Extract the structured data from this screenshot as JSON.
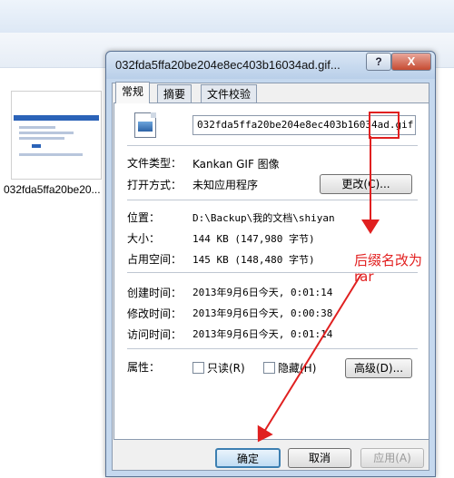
{
  "explorer": {
    "thumbnail_label": "032fda5ffa20be20..."
  },
  "dialog": {
    "title": "032fda5ffa20be204e8ec403b16034ad.gif...",
    "help_label": "?",
    "close_label": "X",
    "tabs": [
      "常规",
      "摘要",
      "文件校验"
    ],
    "file_name": "032fda5ffa20be204e8ec403b16034ad.gif",
    "type_label": "文件类型：",
    "type_value": "Kankan GIF 图像",
    "open_label": "打开方式：",
    "open_value": "未知应用程序",
    "change_button": "更改(C)...",
    "location_label": "位置：",
    "location_value": "D:\\Backup\\我的文档\\shiyan",
    "size_label": "大小：",
    "size_value": "144 KB (147,980 字节)",
    "disk_label": "占用空间：",
    "disk_value": "145 KB (148,480 字节)",
    "created_label": "创建时间：",
    "created_value": "2013年9月6日今天, 0:01:14",
    "modified_label": "修改时间：",
    "modified_value": "2013年9月6日今天, 0:00:38",
    "accessed_label": "访问时间：",
    "accessed_value": "2013年9月6日今天, 0:01:14",
    "attributes_label": "属性：",
    "readonly_label": "只读(R)",
    "hidden_label": "隐藏(H)",
    "advanced_button": "高级(D)...",
    "ok_button": "确定",
    "cancel_button": "取消",
    "apply_button": "应用(A)"
  },
  "annotation": {
    "line1": "后缀名改为",
    "line2": "rar",
    "color": "#e22020"
  }
}
